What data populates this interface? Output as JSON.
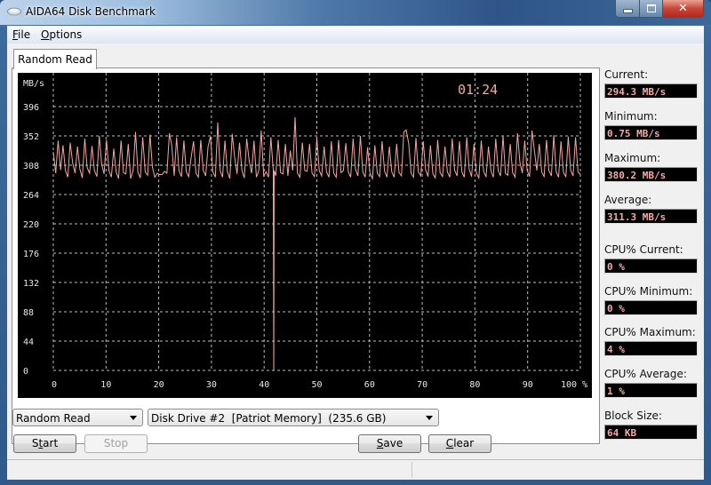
{
  "window": {
    "title": "AIDA64 Disk Benchmark",
    "controls": {
      "minimize": "minimize-icon",
      "maximize": "maximize-icon",
      "close": "close-icon"
    }
  },
  "menu": [
    {
      "label": "File",
      "accel": "F",
      "rest": "ile"
    },
    {
      "label": "Options",
      "accel": "O",
      "rest": "ptions"
    }
  ],
  "tabs": [
    {
      "label": "Random Read",
      "active": true
    }
  ],
  "chart": {
    "timer": "01:24"
  },
  "stats": {
    "current": {
      "label": "Current:",
      "value": "294.3 MB/s"
    },
    "minimum": {
      "label": "Minimum:",
      "value": "0.75 MB/s"
    },
    "maximum": {
      "label": "Maximum:",
      "value": "380.2 MB/s"
    },
    "average": {
      "label": "Average:",
      "value": "311.3 MB/s"
    },
    "cpu_current": {
      "label": "CPU% Current:",
      "value": "0 %"
    },
    "cpu_minimum": {
      "label": "CPU% Minimum:",
      "value": "0 %"
    },
    "cpu_maximum": {
      "label": "CPU% Maximum:",
      "value": "4 %"
    },
    "cpu_average": {
      "label": "CPU% Average:",
      "value": "1 %"
    },
    "block_size": {
      "label": "Block Size:",
      "value": "64 KB"
    }
  },
  "controls": {
    "test_select": {
      "value": "Random Read"
    },
    "drive_select": {
      "value": "Disk Drive #2  [Patriot Memory]  (235.6 GB)"
    },
    "start": {
      "label": "Start",
      "accel": "t",
      "pre": "S",
      "post": "art"
    },
    "stop": {
      "label": "Stop",
      "disabled": true
    },
    "save": {
      "label": "Save",
      "accel": "S",
      "post": "ave"
    },
    "clear": {
      "label": "Clear",
      "accel": "C",
      "post": "lear"
    }
  },
  "colors": {
    "line": "#f2a7a5",
    "chart_bg": "#000000",
    "grid": "#bdbdbd",
    "value_text": "#f2aaa8"
  },
  "chart_data": {
    "type": "line",
    "title": "Random Read",
    "xlabel": "%",
    "ylabel": "MB/s",
    "xlim": [
      0,
      100
    ],
    "ylim": [
      0,
      396
    ],
    "x_ticks": [
      0,
      10,
      20,
      30,
      40,
      50,
      60,
      70,
      80,
      90,
      100
    ],
    "x_tick_labels": [
      "0",
      "10",
      "20",
      "30",
      "40",
      "50",
      "60",
      "70",
      "80",
      "90",
      "100 %"
    ],
    "y_ticks": [
      0,
      44,
      88,
      132,
      176,
      220,
      264,
      308,
      352,
      396
    ],
    "grid": true,
    "legend": "none",
    "annotation": "01:24",
    "series": [
      {
        "name": "Random Read",
        "x_range": [
          0,
          100
        ],
        "summary": {
          "current": 294.3,
          "min": 0.75,
          "max": 380.2,
          "avg": 311.3
        },
        "dip": {
          "x": 41.8,
          "value": 0.75
        },
        "values": [
          328,
          296,
          345,
          301,
          338,
          300,
          290,
          342,
          311,
          296,
          336,
          302,
          289,
          348,
          304,
          296,
          337,
          300,
          291,
          352,
          309,
          295,
          346,
          300,
          290,
          333,
          298,
          288,
          345,
          297,
          295,
          340,
          288,
          300,
          358,
          297,
          289,
          350,
          298,
          293,
          354,
          305,
          290,
          296,
          294,
          294,
          299,
          296,
          356,
          337,
          292,
          350,
          300,
          291,
          345,
          298,
          291,
          320,
          344,
          296,
          290,
          346,
          300,
          292,
          336,
          351,
          298,
          290,
          372,
          300,
          290,
          345,
          298,
          288,
          355,
          320,
          295,
          342,
          300,
          289,
          348,
          315,
          296,
          345,
          290,
          300,
          360,
          292,
          298,
          290,
          350,
          300,
          292,
          346,
          297,
          295,
          340,
          292,
          330,
          300,
          380,
          296,
          290,
          342,
          300,
          299,
          340,
          296,
          291,
          350,
          300,
          292,
          336,
          298,
          290,
          344,
          296,
          290,
          346,
          297,
          300,
          341,
          298,
          290,
          348,
          302,
          292,
          352,
          298,
          290,
          335,
          296,
          288,
          338,
          296,
          291,
          344,
          299,
          290,
          336,
          298,
          290,
          340,
          297,
          292,
          358,
          361,
          340,
          296,
          290,
          349,
          298,
          292,
          344,
          301,
          291,
          338,
          295,
          289,
          346,
          297,
          291,
          336,
          298,
          290,
          348,
          300,
          292,
          344,
          298,
          290,
          350,
          302,
          291,
          340,
          296,
          289,
          345,
          298,
          291,
          336,
          299,
          290,
          348,
          300,
          292,
          352,
          296,
          293,
          340,
          297,
          290,
          356,
          312,
          296,
          345,
          300,
          291,
          360,
          330,
          300,
          340,
          298,
          291,
          346,
          300,
          292,
          353,
          298,
          290,
          344,
          297,
          291,
          351,
          300,
          292,
          350,
          298,
          294
        ]
      }
    ]
  }
}
